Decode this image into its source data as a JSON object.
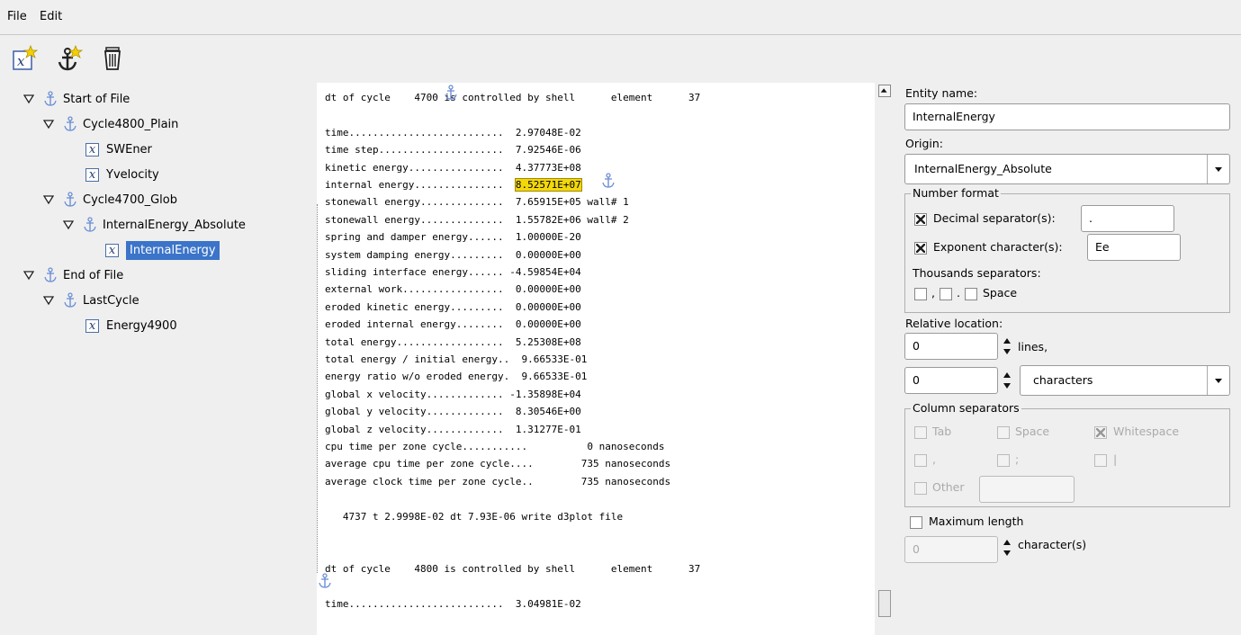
{
  "menu": {
    "file": "File",
    "edit": "Edit"
  },
  "toolbar": {
    "items": [
      {
        "icon": "new-variable-icon"
      },
      {
        "icon": "new-anchor-icon"
      },
      {
        "icon": "trash-icon"
      }
    ]
  },
  "tree": {
    "nodes": [
      {
        "label": "Start of File",
        "type": "anchor",
        "expanded": true
      },
      {
        "label": "Cycle4800_Plain",
        "type": "anchor",
        "expanded": true
      },
      {
        "label": "SWEner",
        "type": "variable"
      },
      {
        "label": "Yvelocity",
        "type": "variable"
      },
      {
        "label": "Cycle4700_Glob",
        "type": "anchor",
        "expanded": true
      },
      {
        "label": "InternalEnergy_Absolute",
        "type": "anchor",
        "expanded": true
      },
      {
        "label": "InternalEnergy",
        "type": "variable",
        "selected": true
      },
      {
        "label": "End of File",
        "type": "anchor",
        "expanded": true
      },
      {
        "label": "LastCycle",
        "type": "anchor",
        "expanded": true
      },
      {
        "label": "Energy4900",
        "type": "variable"
      }
    ]
  },
  "text": {
    "lines": [
      {
        "pre": "dt of cycle    4700 is controlled by shell      element      37",
        "post": ""
      },
      {
        "pre": "",
        "post": ""
      },
      {
        "pre": "time..........................  2.97048E-02",
        "post": ""
      },
      {
        "pre": "time step.....................  7.92546E-06",
        "post": ""
      },
      {
        "pre": "kinetic energy................  4.37773E+08",
        "post": ""
      },
      {
        "pre": "internal energy...............  ",
        "hl": "8.52571E+07",
        "post": ""
      },
      {
        "pre": "stonewall energy..............  7.65915E+05 wall# 1",
        "post": ""
      },
      {
        "pre": "stonewall energy..............  1.55782E+06 wall# 2",
        "post": ""
      },
      {
        "pre": "spring and damper energy......  1.00000E-20",
        "post": ""
      },
      {
        "pre": "system damping energy.........  0.00000E+00",
        "post": ""
      },
      {
        "pre": "sliding interface energy...... -4.59854E+04",
        "post": ""
      },
      {
        "pre": "external work.................  0.00000E+00",
        "post": ""
      },
      {
        "pre": "eroded kinetic energy.........  0.00000E+00",
        "post": ""
      },
      {
        "pre": "eroded internal energy........  0.00000E+00",
        "post": ""
      },
      {
        "pre": "total energy..................  5.25308E+08",
        "post": ""
      },
      {
        "pre": "total energy / initial energy..  9.66533E-01",
        "post": ""
      },
      {
        "pre": "energy ratio w/o eroded energy.  9.66533E-01",
        "post": ""
      },
      {
        "pre": "global x velocity............. -1.35898E+04",
        "post": ""
      },
      {
        "pre": "global y velocity.............  8.30546E+00",
        "post": ""
      },
      {
        "pre": "global z velocity.............  1.31277E-01",
        "post": ""
      },
      {
        "pre": "cpu time per zone cycle...........          0 nanoseconds",
        "post": ""
      },
      {
        "pre": "average cpu time per zone cycle....        735 nanoseconds",
        "post": ""
      },
      {
        "pre": "average clock time per zone cycle..        735 nanoseconds",
        "post": ""
      },
      {
        "pre": "",
        "post": ""
      },
      {
        "pre": "   4737 t 2.9998E-02 dt 7.93E-06 write d3plot file",
        "post": ""
      },
      {
        "pre": "",
        "post": ""
      },
      {
        "pre": "",
        "post": ""
      },
      {
        "pre": "dt of cycle    4800 is controlled by shell      element      37",
        "post": ""
      },
      {
        "pre": "",
        "post": ""
      },
      {
        "pre": "time..........................  3.04981E-02",
        "post": ""
      }
    ]
  },
  "panel": {
    "entity_name_label": "Entity name:",
    "entity_name_value": "InternalEnergy",
    "origin_label": "Origin:",
    "origin_value": "InternalEnergy_Absolute",
    "number_format": {
      "title": "Number format",
      "decimal_label": "Decimal separator(s):",
      "decimal_value": ".",
      "exponent_label": "Exponent character(s):",
      "exponent_value": "Ee",
      "thousands_label": "Thousands separators:",
      "comma": ",",
      "period": ".",
      "space": "Space"
    },
    "relative_location_label": "Relative location:",
    "lines_value": "0",
    "lines_label": "lines,",
    "chars_value": "0",
    "chars_unit": "characters",
    "column_separators": {
      "title": "Column separators",
      "tab": "Tab",
      "space": "Space",
      "whitespace": "Whitespace",
      "comma": ",",
      "semicolon": ";",
      "pipe": "|",
      "other": "Other"
    },
    "max_length_label": "Maximum length",
    "max_length_value": "0",
    "max_length_unit": "character(s)"
  },
  "colors": {
    "selection": "#3b74c9",
    "highlight": "#f2d70c"
  }
}
